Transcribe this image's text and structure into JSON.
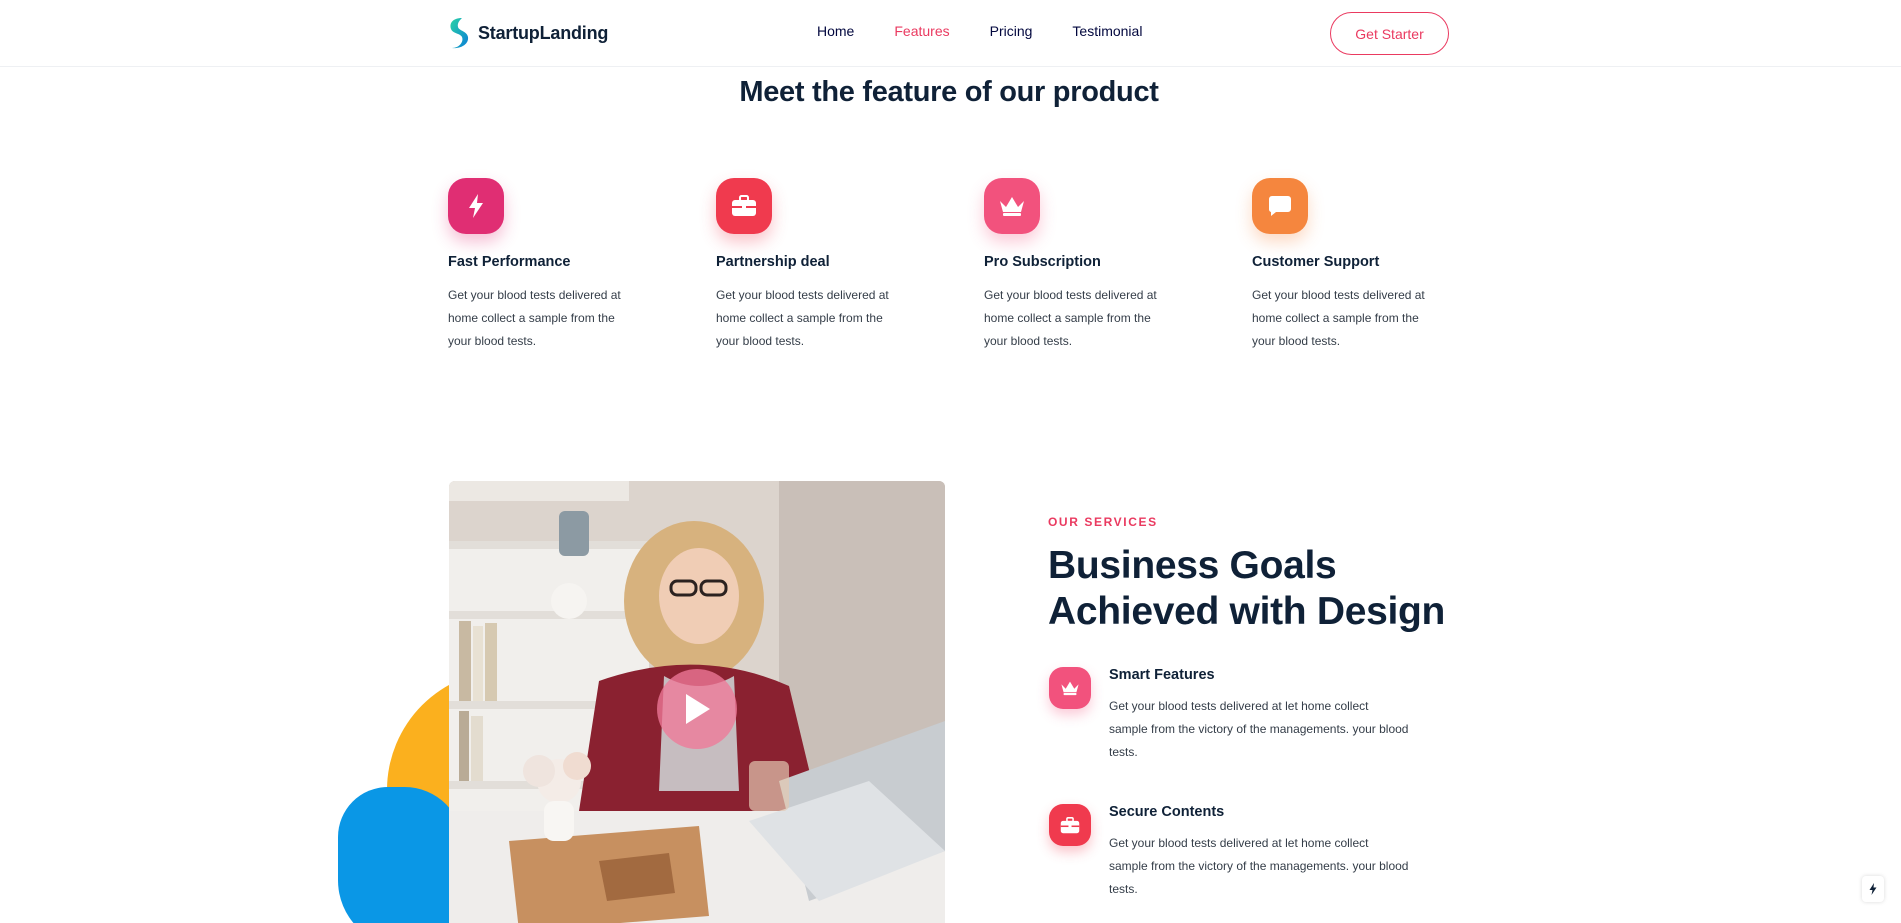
{
  "header": {
    "brand": "StartupLanding",
    "nav": [
      {
        "label": "Home",
        "active": false
      },
      {
        "label": "Features",
        "active": true
      },
      {
        "label": "Pricing",
        "active": false
      },
      {
        "label": "Testimonial",
        "active": false
      }
    ],
    "cta_label": "Get Starter"
  },
  "features": {
    "title": "Meet the feature of our product",
    "cards": [
      {
        "icon": "lightning-icon",
        "color": "#e02e73",
        "title": "Fast Performance",
        "text": "Get your blood tests delivered at home collect a sample from the your blood tests."
      },
      {
        "icon": "briefcase-icon",
        "color": "#f03a4e",
        "title": "Partnership deal",
        "text": "Get your blood tests delivered at home collect a sample from the your blood tests."
      },
      {
        "icon": "crown-icon",
        "color": "#f2527d",
        "title": "Pro Subscription",
        "text": "Get your blood tests delivered at home collect a sample from the your blood tests."
      },
      {
        "icon": "chat-icon",
        "color": "#f5863e",
        "title": "Customer Support",
        "text": "Get your blood tests delivered at home collect a sample from the your blood tests."
      }
    ]
  },
  "services": {
    "label": "OUR SERVICES",
    "title": "Business Goals Achieved with Design",
    "items": [
      {
        "icon": "crown-icon",
        "color": "#f2527d",
        "title": "Smart Features",
        "text": "Get your blood tests delivered at let home collect sample from the victory of the managements. your blood tests."
      },
      {
        "icon": "briefcase-icon",
        "color": "#f03a4e",
        "title": "Secure Contents",
        "text": "Get your blood tests delivered at let home collect sample from the victory of the managements. your blood tests."
      }
    ]
  },
  "colors": {
    "accent": "#ea3a60",
    "heading": "#0f2137",
    "body": "#343d48"
  }
}
